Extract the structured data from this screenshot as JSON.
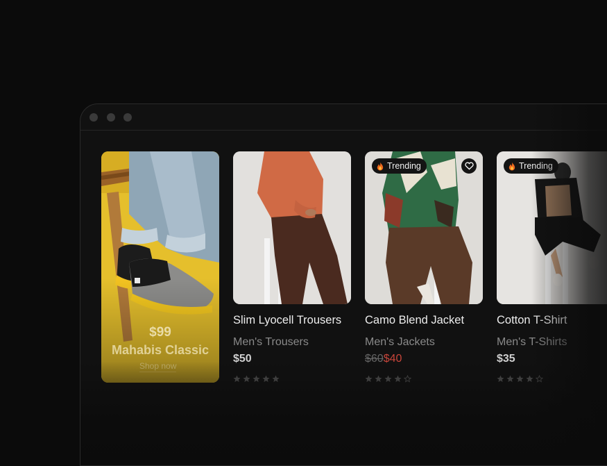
{
  "promo": {
    "price": "$99",
    "name": "Mahabis Classic",
    "cta": "Shop now"
  },
  "products": [
    {
      "title": "Slim Lyocell Trousers",
      "category": "Men's Trousers",
      "price": "$50",
      "rating": 5,
      "badge": "",
      "reviews": ""
    },
    {
      "title": "Camo Blend Jacket",
      "category": "Men's Jackets",
      "old_price": "$60",
      "new_price": "$40",
      "rating": 4,
      "badge": "Trending",
      "reviews": ""
    },
    {
      "title": "Cotton T-Shirt",
      "category": "Men's T-Shirts",
      "price": "$35",
      "rating": 4,
      "badge": "Trending",
      "reviews": ""
    }
  ],
  "colors": {
    "accent_sale": "#c8453a",
    "promo_bg": "#e7c02f",
    "background": "#0b0b0b"
  },
  "icons": {
    "window_controls": [
      "circle",
      "circle",
      "circle"
    ],
    "wishlist": "heart-icon",
    "trending": "fire-icon",
    "rating": "star-icon"
  }
}
